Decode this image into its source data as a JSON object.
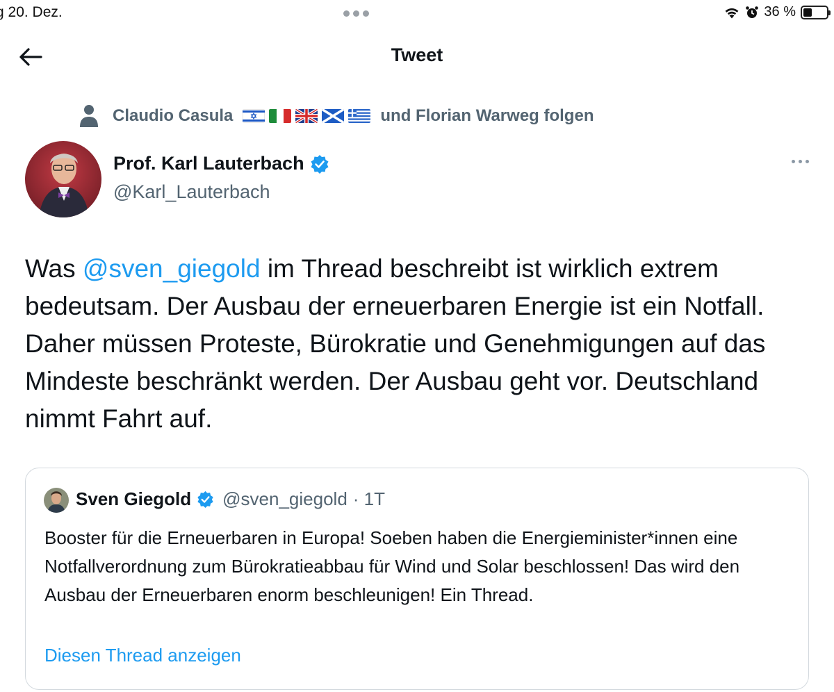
{
  "status_bar": {
    "time_date": "g 20. Dez.",
    "battery_percent": "36 %",
    "battery_level": 0.36,
    "icons": [
      "wifi-icon",
      "alarm-icon",
      "battery-icon"
    ]
  },
  "header": {
    "title": "Tweet",
    "back_icon": "arrow-left-icon"
  },
  "social_context": {
    "icon": "person-icon",
    "prefix": "Claudio Casula",
    "flags": [
      "israel-flag",
      "italy-flag",
      "uk-flag",
      "scotland-flag",
      "greece-flag"
    ],
    "suffix": "und Florian Warweg folgen"
  },
  "author": {
    "name": "Prof. Karl Lauterbach",
    "handle": "@Karl_Lauterbach",
    "verified": true
  },
  "tweet": {
    "text_before": "Was ",
    "mention": "@sven_giegold",
    "text_after": " im Thread beschreibt ist wirklich extrem bedeutsam. Der Ausbau der erneuerbaren Energie ist ein Notfall. Daher müssen Proteste, Bürokratie und Genehmigungen auf das Mindeste beschränkt werden. Der Ausbau geht vor. Deutschland nimmt Fahrt auf."
  },
  "quoted_tweet": {
    "name": "Sven Giegold",
    "verified": true,
    "handle": "@sven_giegold",
    "time": "· 1T",
    "text": "Booster für die Erneuerbaren in Europa! Soeben haben die Energieminister*innen eine Notfallverordnung zum Bürokratieabbau für Wind und Solar beschlossen! Das wird den Ausbau der Erneuerbaren enorm beschleunigen! Ein Thread.",
    "show_thread_label": "Diesen Thread anzeigen"
  },
  "colors": {
    "accent": "#1d9bf0",
    "text_primary": "#0f1419",
    "text_secondary": "#536471",
    "border": "#d3d9de"
  }
}
